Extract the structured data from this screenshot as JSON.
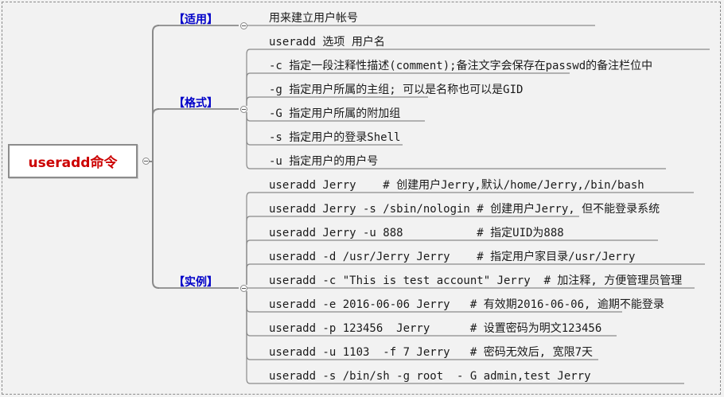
{
  "root": {
    "label": "useradd命令"
  },
  "categories": [
    {
      "label": "【适用】",
      "items": [
        "用来建立用户帐号"
      ]
    },
    {
      "label": "【格式】",
      "items": [
        "useradd 选项 用户名",
        "-c 指定一段注释性描述(comment);备注文字会保存在passwd的备注栏位中",
        "-g 指定用户所属的主组; 可以是名称也可以是GID",
        "-G 指定用户所属的附加组",
        "-s 指定用户的登录Shell",
        "-u 指定用户的用户号"
      ]
    },
    {
      "label": "【实例】",
      "items": [
        "useradd Jerry    # 创建用户Jerry,默认/home/Jerry,/bin/bash",
        "useradd Jerry -s /sbin/nologin # 创建用户Jerry, 但不能登录系统",
        "useradd Jerry -u 888           # 指定UID为888",
        "useradd -d /usr/Jerry Jerry    # 指定用户家目录/usr/Jerry",
        "useradd -c \"This is test account\" Jerry  # 加注释, 方便管理员管理",
        "useradd -e 2016-06-06 Jerry   # 有效期2016-06-06, 逾期不能登录",
        "useradd -p 123456  Jerry      # 设置密码为明文123456",
        "useradd -u 1103  -f 7 Jerry   # 密码无效后, 宽限7天",
        "useradd -s /bin/sh -g root  - G admin,test Jerry"
      ]
    }
  ],
  "colors": {
    "line": "#8a8a8a",
    "root_text": "#cc0000",
    "category_text": "#0000c8"
  }
}
